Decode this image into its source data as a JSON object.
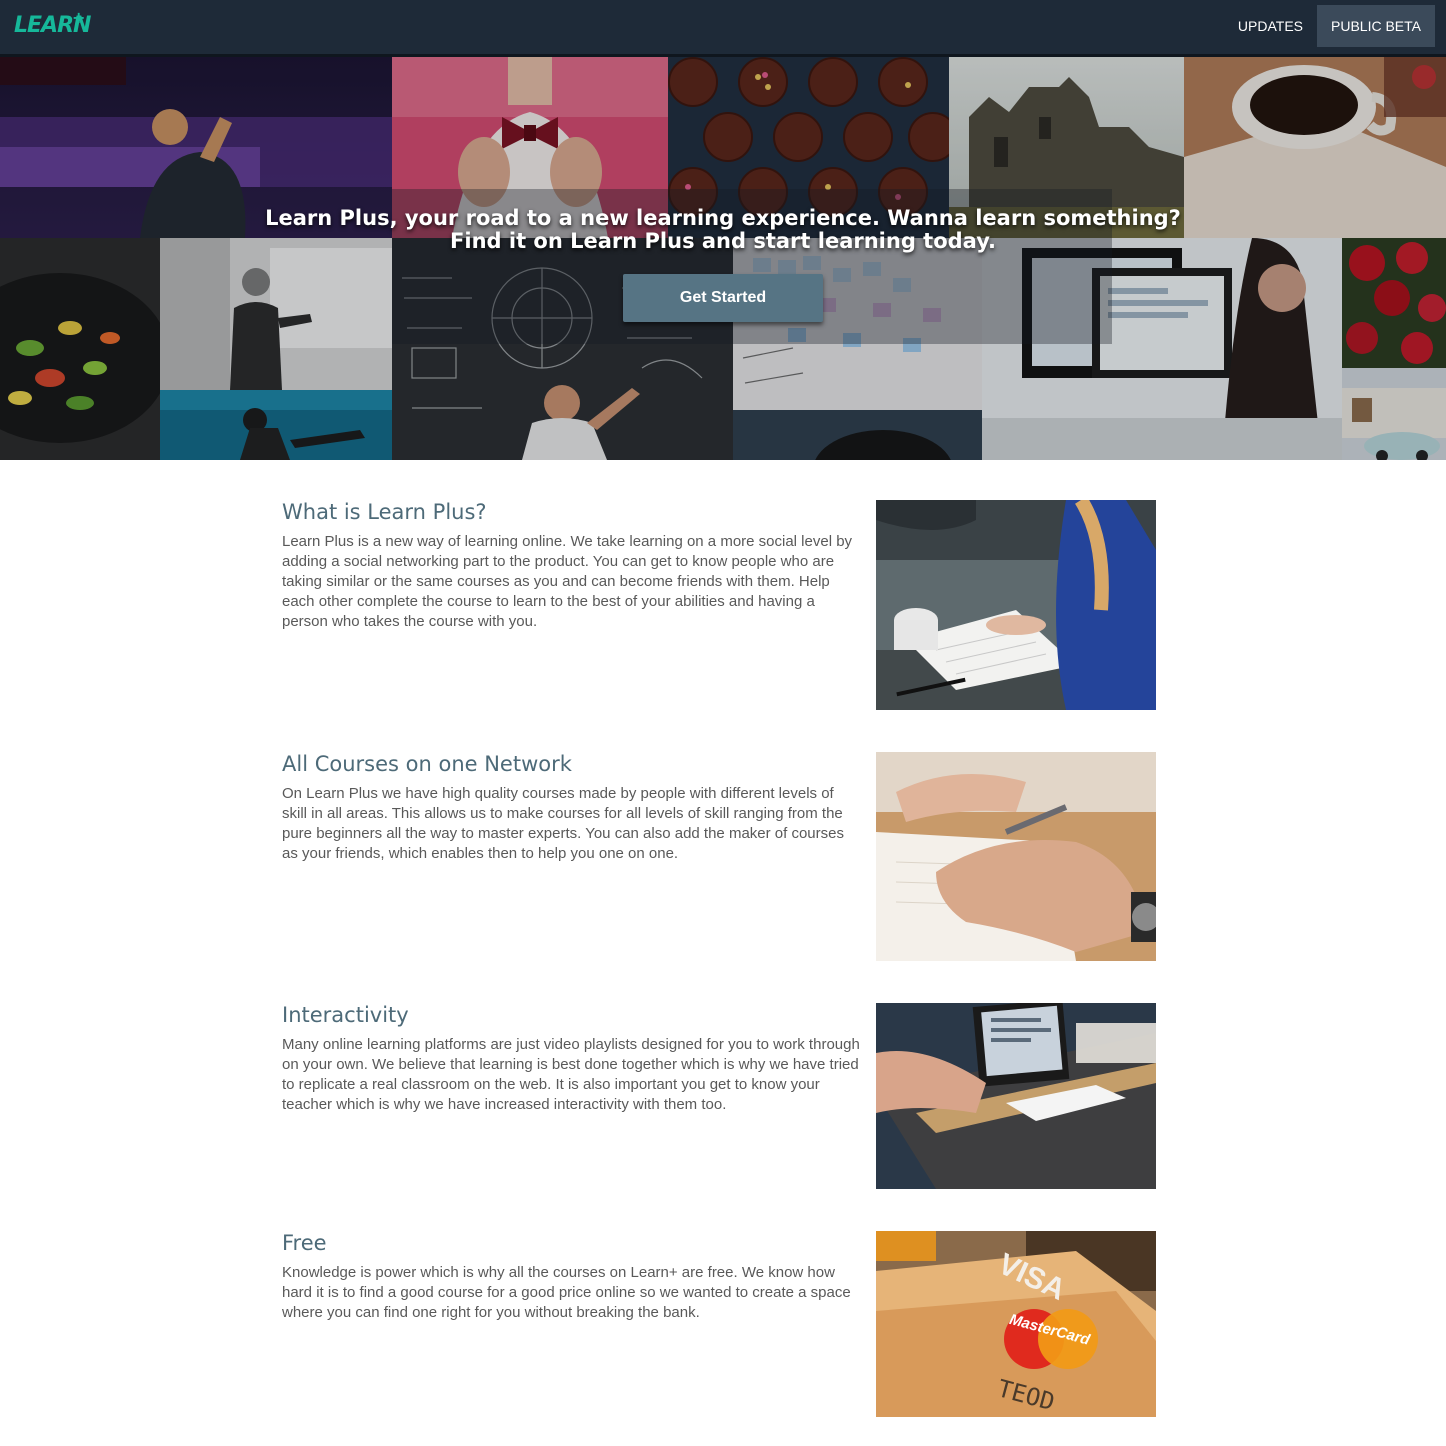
{
  "brand": {
    "logo_text": "LEARN",
    "logo_plus": "+",
    "accent_color": "#16b89a",
    "nav_bg": "#1e2a38"
  },
  "nav": {
    "items": [
      {
        "label": "UPDATES",
        "active": false
      },
      {
        "label": "PUBLIC BETA",
        "active": true
      }
    ]
  },
  "hero": {
    "headline_line1": "Learn Plus, your road to a new learning experience. Wanna learn something?",
    "headline_line2": "Find it on Learn Plus and start learning today.",
    "cta_label": "Get Started",
    "cta_color": "#567484",
    "collage_tiles": [
      "concert-crowd",
      "bow-tie",
      "cupcakes",
      "ruins",
      "coffee-cup",
      "stir-fry",
      "teacher-whiteboard",
      "scuba-diver",
      "chalkboard-equations",
      "sticky-notes-board",
      "microphone",
      "computer-desk",
      "red-roses"
    ]
  },
  "sections": [
    {
      "title": "What is Learn Plus?",
      "body": "Learn Plus is a new way of learning online. We take learning on a more social level by adding a social networking part to the product. You can get to know people who are taking similar or the same courses as you and can become friends with them. Help each other complete the course to learn to the best of your abilities and having a person who takes the course with you.",
      "image": "students-notebook-photo"
    },
    {
      "title": "All Courses on one Network",
      "body": "On Learn Plus we have high quality courses made by people with different levels of skill in all areas. This allows us to make courses for all levels of skill ranging from the pure beginners all the way to master experts. You can also add the maker of courses as your friends, which enables then to help you one on one.",
      "image": "hand-writing-photo"
    },
    {
      "title": "Interactivity",
      "body": "Many online learning platforms are just video playlists designed for you to work through on your own. We believe that learning is best done together which is why we have tried to replicate a real classroom on the web. It is also important you get to know your teacher which is why we have increased interactivity with them too.",
      "image": "laptop-desk-photo"
    },
    {
      "title": "Free",
      "body": "Knowledge is power which is why all the courses on Learn+ are free. We know how hard it is to find a good course for a good price online so we wanted to create a space where you can find one right for you without breaking the bank.",
      "image": "credit-cards-photo",
      "image_text": {
        "visa": "VISA",
        "mastercard": "MasterCard",
        "card_name": "TEOD"
      }
    }
  ]
}
